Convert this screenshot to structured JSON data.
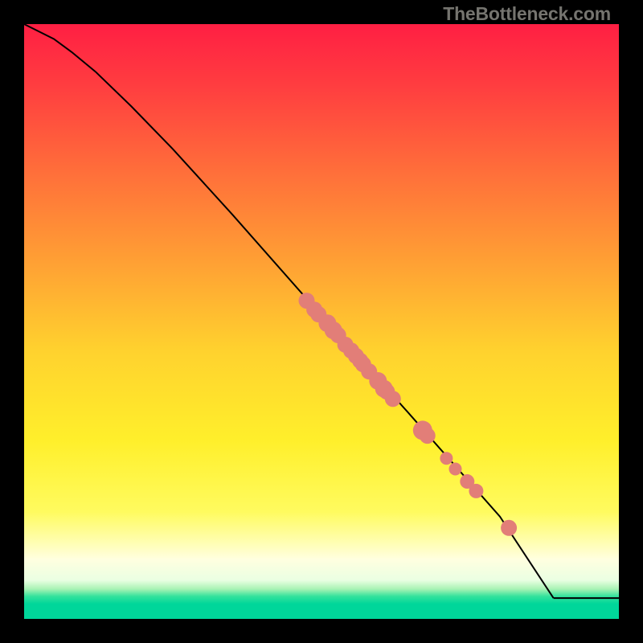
{
  "watermark": "TheBottleneck.com",
  "colors": {
    "marker": "#e27e78",
    "line": "#000000"
  },
  "chart_data": {
    "type": "line",
    "title": "",
    "xlabel": "",
    "ylabel": "",
    "xlim": [
      0,
      100
    ],
    "ylim": [
      0,
      100
    ],
    "grid": false,
    "legend": false,
    "background_gradient_stops": [
      {
        "t": 0.0,
        "color": "#ff1f43"
      },
      {
        "t": 0.1,
        "color": "#ff3c40"
      },
      {
        "t": 0.25,
        "color": "#ff6f3a"
      },
      {
        "t": 0.4,
        "color": "#ffa034"
      },
      {
        "t": 0.55,
        "color": "#ffd22e"
      },
      {
        "t": 0.7,
        "color": "#ffef2b"
      },
      {
        "t": 0.82,
        "color": "#fffb5f"
      },
      {
        "t": 0.9,
        "color": "#ffffe0"
      },
      {
        "t": 0.935,
        "color": "#eaffe2"
      },
      {
        "t": 0.95,
        "color": "#a7f2b4"
      },
      {
        "t": 0.962,
        "color": "#34e29c"
      },
      {
        "t": 0.975,
        "color": "#00d69a"
      },
      {
        "t": 1.0,
        "color": "#00d69a"
      }
    ],
    "series": [
      {
        "name": "curve",
        "x": [
          0,
          2,
          5,
          8,
          12,
          18,
          25,
          35,
          50,
          65,
          80,
          89
        ],
        "y": [
          100,
          99,
          97.5,
          95.3,
          92,
          86.2,
          79,
          68,
          51,
          34.2,
          17.2,
          3.5
        ]
      },
      {
        "name": "tail-flat",
        "x": [
          89,
          100
        ],
        "y": [
          3.5,
          3.5
        ]
      }
    ],
    "markers": {
      "name": "highlight-points",
      "x": [
        47.5,
        48.8,
        49.5,
        51.0,
        52.0,
        52.8,
        54.0,
        55.0,
        55.8,
        56.5,
        57.0,
        58.0,
        59.5,
        60.5,
        61.0,
        62.0,
        67.0,
        67.8,
        71.0,
        72.5,
        74.5,
        76.0,
        81.5
      ],
      "y": [
        53.5,
        52.0,
        51.2,
        49.7,
        48.5,
        47.7,
        46.1,
        45.1,
        44.2,
        43.4,
        42.8,
        41.6,
        40.0,
        38.7,
        38.2,
        37.0,
        31.7,
        30.8,
        27.0,
        25.2,
        23.1,
        21.5,
        15.3
      ],
      "radius": [
        10,
        10,
        10,
        11,
        11,
        10,
        10,
        10,
        10,
        10,
        10,
        10,
        11,
        11,
        10,
        10,
        12,
        10,
        8,
        8,
        9,
        9,
        10
      ]
    }
  }
}
